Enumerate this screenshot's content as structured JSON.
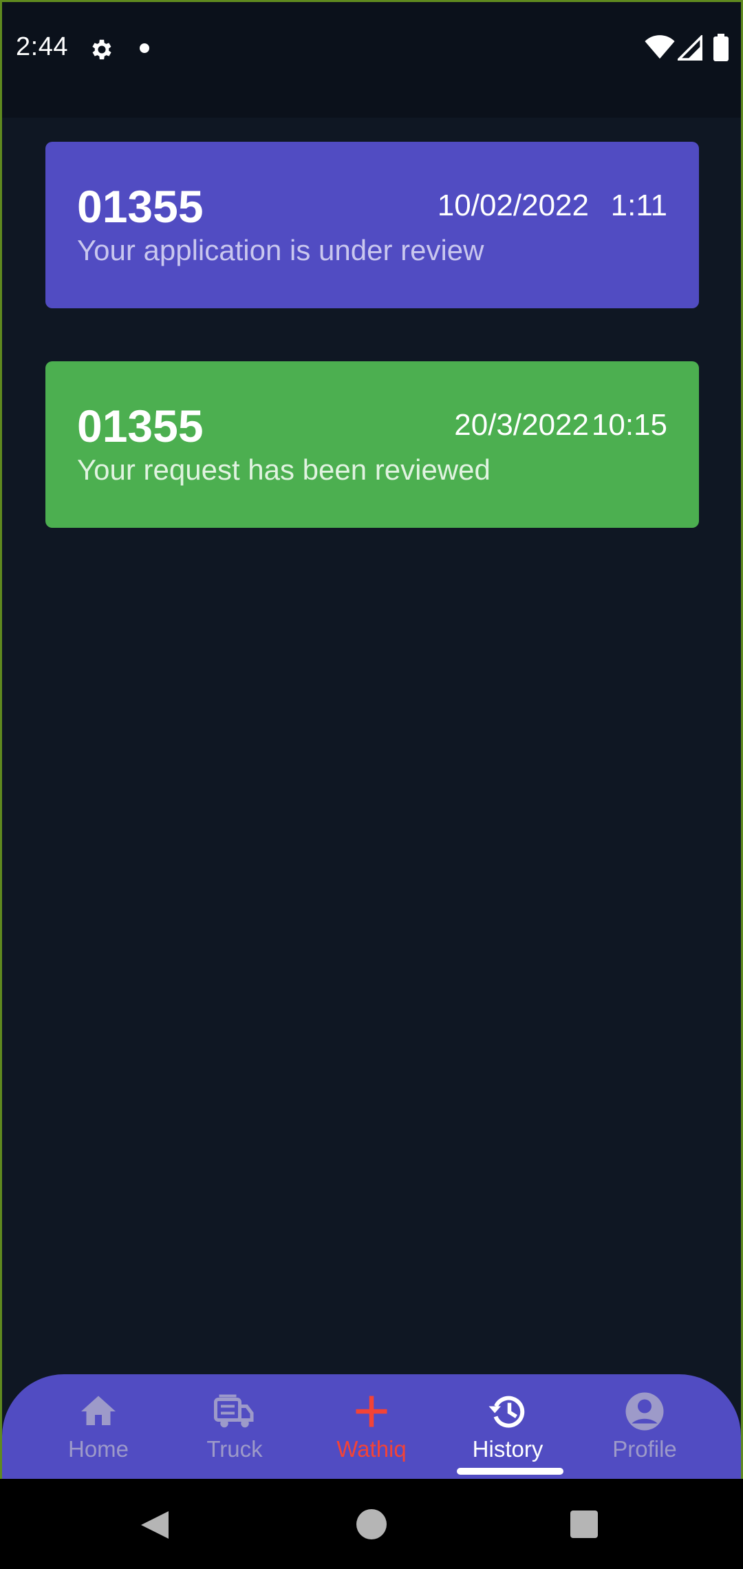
{
  "status_bar": {
    "time": "2:44",
    "icons": [
      "gear-icon",
      "notification-dot-icon",
      "wifi-icon",
      "signal-icon",
      "battery-icon"
    ]
  },
  "history": [
    {
      "id": "01355",
      "date": "10/02/2022",
      "time": "1:11",
      "message": "Your application is under review",
      "color": "#514cc2"
    },
    {
      "id": "01355",
      "date": "20/3/2022",
      "time": "10:15",
      "message": "Your request has been reviewed",
      "color": "#4caf50"
    }
  ],
  "bottom_nav": {
    "items": [
      {
        "label": "Home",
        "icon": "home-icon"
      },
      {
        "label": "Truck",
        "icon": "truck-icon"
      },
      {
        "label": "Wathiq",
        "icon": "plus-icon",
        "color": "#f44336"
      },
      {
        "label": "History",
        "icon": "history-icon",
        "active": true
      },
      {
        "label": "Profile",
        "icon": "profile-icon"
      }
    ],
    "background": "#514cc2"
  },
  "system_nav": [
    "back-icon",
    "home-circle-icon",
    "recents-icon"
  ]
}
